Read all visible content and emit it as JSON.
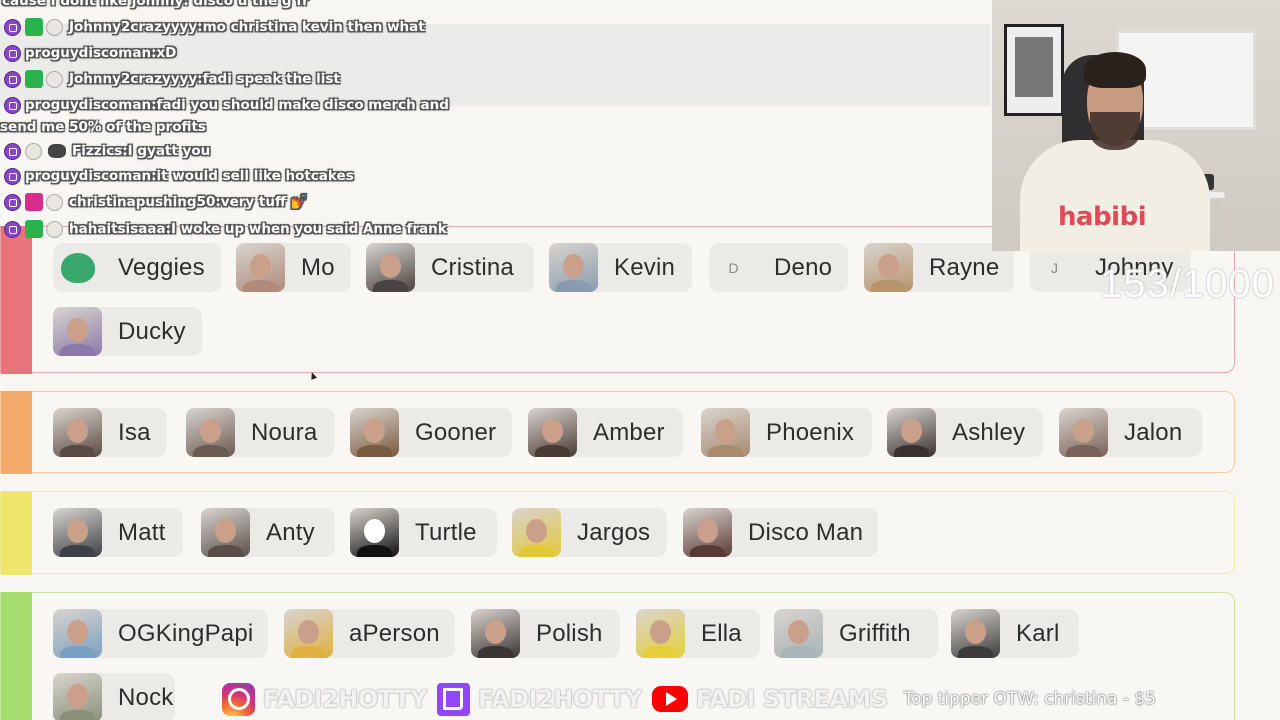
{
  "chat": {
    "top_line": "cause I dont like johnny: disco u the g fr",
    "messages": [
      {
        "user": "Johnny2crazyyyy",
        "text": "mo christina kevin then what",
        "badges": [
          "twitch",
          "sub",
          "egg"
        ]
      },
      {
        "user": "proguydiscoman",
        "text": "xD",
        "badges": [
          "twitch"
        ]
      },
      {
        "user": "Johnny2crazyyyy",
        "text": "fadi speak the list",
        "badges": [
          "twitch",
          "sub",
          "egg"
        ]
      },
      {
        "user": "proguydiscoman",
        "text": "fadi you should make disco merch and",
        "badges": [
          "twitch"
        ]
      },
      {
        "user": "",
        "text": "send me 50% of the profits",
        "badges": []
      },
      {
        "user": "Fizzics",
        "text": "I gyatt you",
        "badges": [
          "twitch",
          "egg",
          "bug"
        ]
      },
      {
        "user": "proguydiscoman",
        "text": "it would sell like hotcakes",
        "badges": [
          "twitch"
        ]
      },
      {
        "user": "christinapushing50",
        "text": "very tuff 💅",
        "badges": [
          "twitch",
          "pink",
          "egg"
        ]
      },
      {
        "user": "hahaitsisaaa",
        "text": "I woke up when you said Anne frank",
        "badges": [
          "twitch",
          "sub",
          "egg"
        ]
      }
    ]
  },
  "webcam": {
    "shirt_text": "habibi"
  },
  "goal_counter": "153/1000",
  "tiers": [
    {
      "color": "#e8737a",
      "items": [
        {
          "name": "Veggies",
          "avatar": "frog",
          "avcolor": "#3aa76d"
        },
        {
          "name": "Mo",
          "avatar": "face",
          "avcolor": "#b18a7a"
        },
        {
          "name": "Cristina",
          "avatar": "face",
          "avcolor": "#4a4341"
        },
        {
          "name": "Kevin",
          "avatar": "face",
          "avcolor": "#8a9bb0"
        },
        {
          "name": "Deno",
          "avatar": "letter",
          "letter": "D"
        },
        {
          "name": "Rayne",
          "avatar": "face",
          "avcolor": "#b7946b"
        },
        {
          "name": "Johnny",
          "avatar": "letter",
          "letter": "J"
        },
        {
          "name": "Ducky",
          "avatar": "face",
          "avcolor": "#8b7aa8"
        }
      ]
    },
    {
      "color": "#f2a96a",
      "items": [
        {
          "name": "Isa",
          "avatar": "face",
          "avcolor": "#5a4a44"
        },
        {
          "name": "Noura",
          "avatar": "face",
          "avcolor": "#6b5a52"
        },
        {
          "name": "Gooner",
          "avatar": "face",
          "avcolor": "#7a5a40"
        },
        {
          "name": "Amber",
          "avatar": "face",
          "avcolor": "#4a3a34"
        },
        {
          "name": "Phoenix",
          "avatar": "face",
          "avcolor": "#a88a70"
        },
        {
          "name": "Ashley",
          "avatar": "face",
          "avcolor": "#3a3230"
        },
        {
          "name": "Jalon",
          "avatar": "face",
          "avcolor": "#7a6258"
        }
      ]
    },
    {
      "color": "#ede66b",
      "items": [
        {
          "name": "Matt",
          "avatar": "face",
          "avcolor": "#3c4148"
        },
        {
          "name": "Anty",
          "avatar": "face",
          "avcolor": "#5a4e48"
        },
        {
          "name": "Turtle",
          "avatar": "kitty",
          "avcolor": "#111111"
        },
        {
          "name": "Jargos",
          "avatar": "face",
          "avcolor": "#e3c83a"
        },
        {
          "name": "Disco Man",
          "avatar": "face",
          "avcolor": "#5a3a36"
        }
      ]
    },
    {
      "color": "#a6db6e",
      "items": [
        {
          "name": "OGKingPapi",
          "avatar": "face",
          "avcolor": "#7aa0c0"
        },
        {
          "name": "aPerson",
          "avatar": "face",
          "avcolor": "#e0b040"
        },
        {
          "name": "Polish",
          "avatar": "face",
          "avcolor": "#3a3432"
        },
        {
          "name": "Ella",
          "avatar": "face",
          "avcolor": "#e6cf3a"
        },
        {
          "name": "Griffith",
          "avatar": "face",
          "avcolor": "#a8b4b8"
        },
        {
          "name": "Karl",
          "avatar": "face",
          "avcolor": "#3c3c3c"
        },
        {
          "name": "Nock",
          "avatar": "face",
          "avcolor": "#8a8f7a"
        }
      ]
    }
  ],
  "footer": {
    "instagram_handle": "FADI2HOTTY",
    "twitch_handle": "FADI2HOTTY",
    "youtube_handle": "FADI STREAMS",
    "tipper_text": "Top tipper OTW: christina - $5"
  }
}
